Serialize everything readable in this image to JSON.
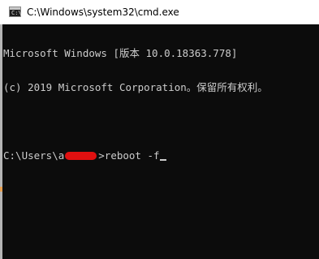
{
  "window": {
    "title": "C:\\Windows\\system32\\cmd.exe",
    "icon": "cmd-console-icon",
    "icon_glyph": "C:\\"
  },
  "console": {
    "line1": "Microsoft Windows [版本 10.0.18363.778]",
    "line2": "(c) 2019 Microsoft Corporation。保留所有权利。",
    "prompt_prefix": "C:\\Users\\a",
    "prompt_suffix": ">",
    "command": "reboot -f"
  },
  "colors": {
    "console_background": "#0c0c0c",
    "console_text": "#cccccc",
    "redaction": "#e01010",
    "titlebar": "#ffffff"
  }
}
